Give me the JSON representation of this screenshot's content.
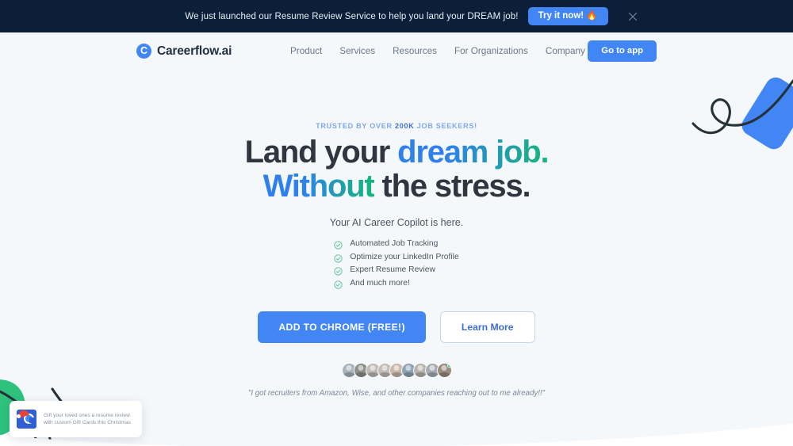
{
  "banner": {
    "message": "We just launched our Resume Review Service to help you land your DREAM job!",
    "cta_label": "Try it now! 🔥",
    "close_icon": "close-icon",
    "background": "#0b1f3a",
    "cta_color": "#4285f4"
  },
  "nav": {
    "brand_mark": "C",
    "brand_name": "Careerflow.ai",
    "links": [
      {
        "label": "Product"
      },
      {
        "label": "Services"
      },
      {
        "label": "Resources"
      },
      {
        "label": "For Organizations"
      },
      {
        "label": "Company"
      }
    ],
    "cta_label": "Go to app",
    "cta_color": "#4285f4"
  },
  "hero": {
    "eyebrow_prefix": "TRUSTED BY OVER ",
    "eyebrow_number": "200K",
    "eyebrow_suffix": " JOB SEEKERS!",
    "headline_line1_plain": "Land your ",
    "headline_line1_accent": "dream job.",
    "headline_line2_accent": "Without",
    "headline_line2_plain": " the stress.",
    "subtitle": "Your AI Career Copilot is here.",
    "features": [
      {
        "label": "Automated Job Tracking",
        "icon": "check-circle-icon"
      },
      {
        "label": "Optimize your LinkedIn Profile",
        "icon": "check-circle-icon"
      },
      {
        "label": "Expert Resume Review",
        "icon": "check-circle-icon"
      },
      {
        "label": "And much more!",
        "icon": "check-circle-icon"
      }
    ],
    "primary_cta": "ADD TO CHROME  (FREE!)",
    "secondary_cta": "Learn More",
    "quote": "\"I got recruiters from Amazon, Wise, and other companies reaching out to me already!!\"",
    "avatar_count": 9,
    "avatar_colors": [
      "#a9b4bd",
      "#8d8f8c",
      "#bdbcb8",
      "#c3bdb6",
      "#c9b8ab",
      "#8fa3b4",
      "#b9b4ad",
      "#a7aeb3",
      "#9a8c7e"
    ],
    "accent_blue": "#2f80ed",
    "accent_green": "#16b67a",
    "headline_color": "#2f3640"
  },
  "popup": {
    "text": "Gift your loved ones a resume review with custom Gift Cards this Christmas",
    "icon": "careerflow-santa-icon"
  },
  "decor": {
    "top_right": "swirl-and-blue-card-decoration",
    "bottom_left": "green-leaf-swirl-decoration",
    "bottom_wave": "white-wave-divider"
  }
}
